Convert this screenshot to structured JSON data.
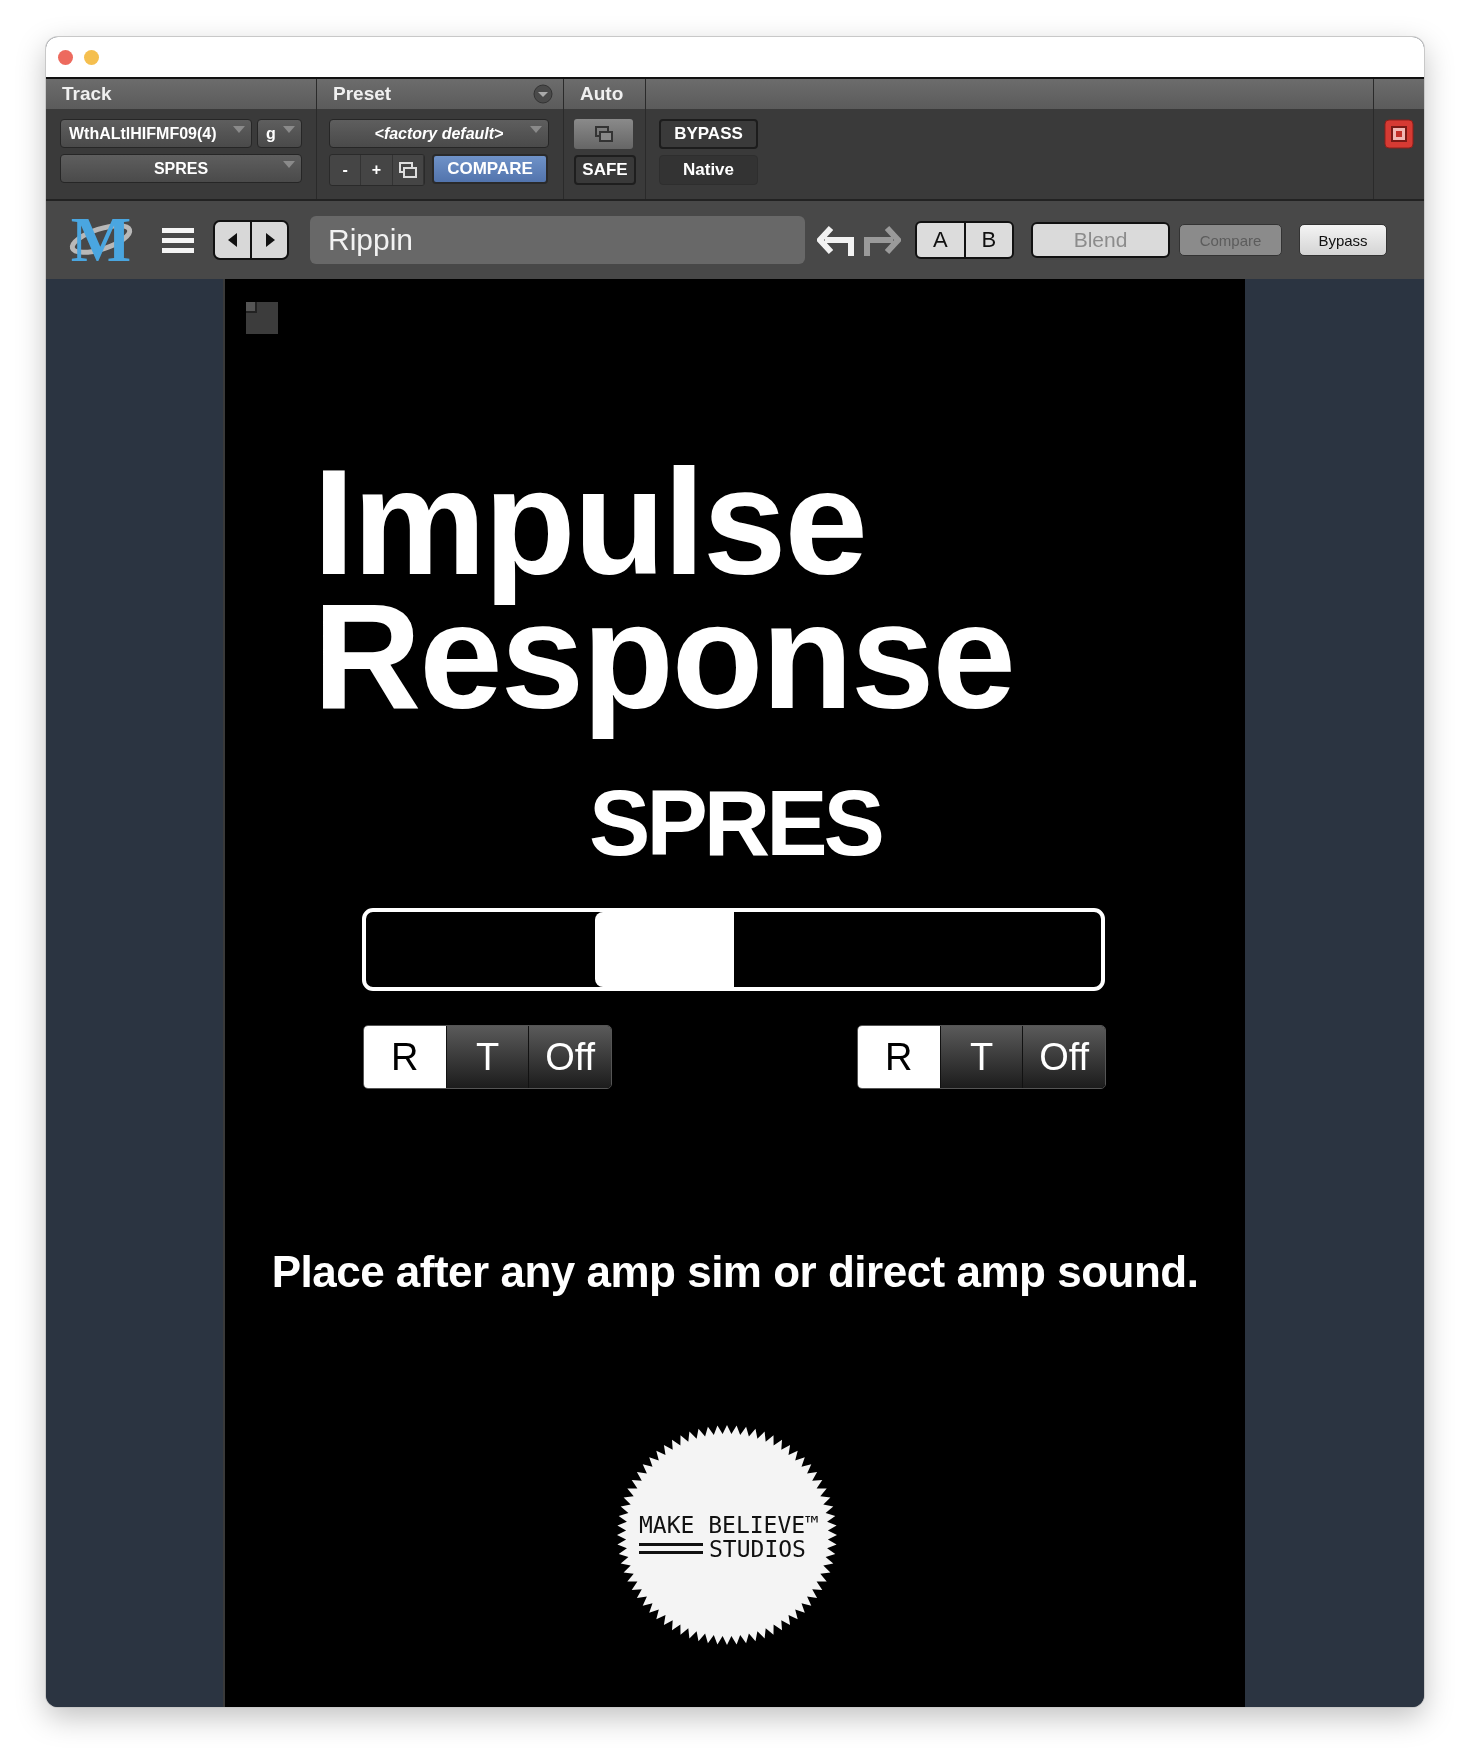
{
  "header": {
    "columns": [
      {
        "label": "Track"
      },
      {
        "label": "Preset"
      },
      {
        "label": "Auto"
      }
    ],
    "track": {
      "name": "WthALtlHIFMF09(4)",
      "group": "g",
      "insert": "SPRES"
    },
    "preset": {
      "name": "<factory default>",
      "minus": "-",
      "plus": "+",
      "compare": {
        "label": "COMPARE",
        "on": true
      }
    },
    "auto": {
      "safe": "SAFE"
    },
    "bypass": {
      "label": "BYPASS",
      "on": false
    },
    "mode": "Native"
  },
  "toolbar": {
    "logo": "M",
    "preset_name": "Rippin",
    "undo_enabled": true,
    "redo_enabled": false,
    "ab": [
      {
        "label": "A"
      },
      {
        "label": "B"
      }
    ],
    "buttons": [
      {
        "kind": "blend",
        "label": "Blend",
        "disabled": true
      },
      {
        "kind": "small",
        "label": "Compare",
        "disabled": true
      },
      {
        "kind": "small",
        "label": "Bypass",
        "disabled": false
      }
    ]
  },
  "plugin": {
    "title_lines": [
      "Impulse",
      "Response"
    ],
    "name": "SPRES",
    "slider": {
      "level": 0.385
    },
    "switches": [
      {
        "options": [
          {
            "label": "R",
            "selected": true
          },
          {
            "label": "T",
            "selected": false
          },
          {
            "label": "Off",
            "selected": false
          }
        ]
      },
      {
        "options": [
          {
            "label": "R",
            "selected": true
          },
          {
            "label": "T",
            "selected": false
          },
          {
            "label": "Off",
            "selected": false
          }
        ]
      }
    ],
    "note": "Place after any amp sim or direct amp sound.",
    "logo": [
      "MAKE BELIEVE™",
      "STUDIOS"
    ]
  }
}
